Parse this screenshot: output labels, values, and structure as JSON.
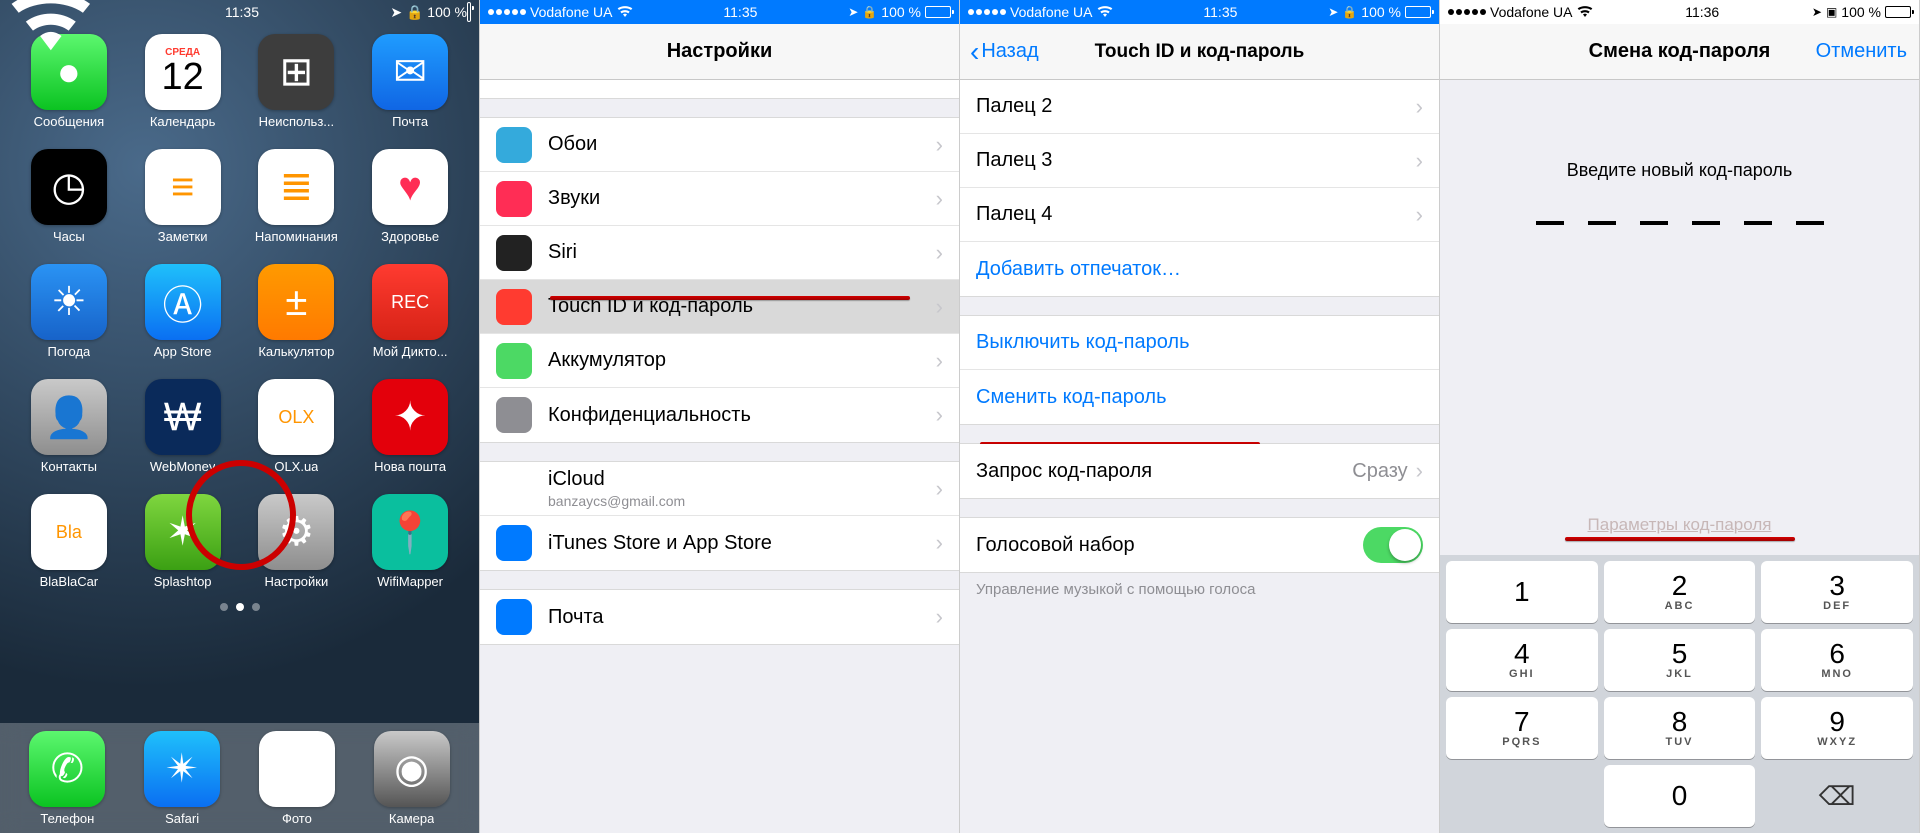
{
  "status": {
    "carrier": "Vodafone UA",
    "time1": "11:35",
    "time4": "11:36",
    "battery": "100 %"
  },
  "screen1": {
    "apps": [
      {
        "label": "Сообщения",
        "bg": "linear-gradient(#5cf76f,#0bc321)",
        "glyph": "●"
      },
      {
        "label": "Календарь",
        "bg": "#fff",
        "glyph": "12",
        "top": "СРЕДА"
      },
      {
        "label": "Неиспольз...",
        "bg": "#3d3d3d",
        "glyph": "⊞"
      },
      {
        "label": "Почта",
        "bg": "linear-gradient(#1f9cff,#1066e4)",
        "glyph": "✉"
      },
      {
        "label": "Часы",
        "bg": "#000",
        "glyph": "◷"
      },
      {
        "label": "Заметки",
        "bg": "#fff",
        "glyph": "≡"
      },
      {
        "label": "Напоминания",
        "bg": "#fff",
        "glyph": "≣"
      },
      {
        "label": "Здоровье",
        "bg": "#fff",
        "glyph": "♥"
      },
      {
        "label": "Погода",
        "bg": "linear-gradient(#2a93f4,#1763c9)",
        "glyph": "☀"
      },
      {
        "label": "App Store",
        "bg": "linear-gradient(#1fc0fb,#0a6ff2)",
        "glyph": "Ⓐ"
      },
      {
        "label": "Калькулятор",
        "bg": "linear-gradient(#ff9a00,#ff7a00)",
        "glyph": "±"
      },
      {
        "label": "Мой Дикто...",
        "bg": "linear-gradient(#ff3b30,#d62216)",
        "glyph": "REC"
      },
      {
        "label": "Контакты",
        "bg": "linear-gradient(#c9c9c9,#8e8e8e)",
        "glyph": "👤"
      },
      {
        "label": "WebMoney",
        "bg": "#0a2a5a",
        "glyph": "₩"
      },
      {
        "label": "OLX.ua",
        "bg": "#fff",
        "glyph": "OLX"
      },
      {
        "label": "Нова пошта",
        "bg": "#e3000b",
        "glyph": "✦"
      },
      {
        "label": "BlaBlaCar",
        "bg": "#fff",
        "glyph": "Bla"
      },
      {
        "label": "Splashtop",
        "bg": "linear-gradient(#7fd63f,#3ba013)",
        "glyph": "✶"
      },
      {
        "label": "Настройки",
        "bg": "linear-gradient(#c9c9c9,#8e8e8e)",
        "glyph": "⚙"
      },
      {
        "label": "WifiMapper",
        "bg": "#0abf9e",
        "glyph": "📍"
      }
    ],
    "dock": [
      {
        "label": "Телефон",
        "bg": "linear-gradient(#5cf76f,#0bc321)",
        "glyph": "✆"
      },
      {
        "label": "Safari",
        "bg": "linear-gradient(#1fc0fb,#0a6ff2)",
        "glyph": "✴"
      },
      {
        "label": "Фото",
        "bg": "#fff",
        "glyph": "✿"
      },
      {
        "label": "Камера",
        "bg": "linear-gradient(#c9c9c9,#555)",
        "glyph": "◉"
      }
    ]
  },
  "screen2": {
    "title": "Настройки",
    "rows1": [
      {
        "label": "Обои",
        "bg": "#34aadc"
      },
      {
        "label": "Звуки",
        "bg": "#ff2d55"
      },
      {
        "label": "Siri",
        "bg": "#222"
      },
      {
        "label": "Touch ID и код-пароль",
        "bg": "#ff3b30",
        "sel": true
      },
      {
        "label": "Аккумулятор",
        "bg": "#4cd964"
      },
      {
        "label": "Конфиденциальность",
        "bg": "#8e8e93"
      }
    ],
    "rows2": [
      {
        "label": "iCloud",
        "sub": "banzaycs@gmail.com",
        "bg": "#fff"
      },
      {
        "label": "iTunes Store и App Store",
        "bg": "#007aff"
      }
    ],
    "rows3": [
      {
        "label": "Почта",
        "bg": "#007aff"
      }
    ]
  },
  "screen3": {
    "back": "Назад",
    "title": "Touch ID и код-пароль",
    "fingers": [
      "Палец 2",
      "Палец 3",
      "Палец 4"
    ],
    "add": "Добавить отпечаток…",
    "disable": "Выключить код-пароль",
    "change": "Сменить код-пароль",
    "request_label": "Запрос код-пароля",
    "request_value": "Сразу",
    "voice": "Голосовой набор",
    "voice_footer": "Управление музыкой с помощью голоса"
  },
  "screen4": {
    "title": "Смена код-пароля",
    "cancel": "Отменить",
    "prompt": "Введите новый код-пароль",
    "options": "Параметры код-пароля",
    "keys": [
      {
        "n": "1",
        "l": ""
      },
      {
        "n": "2",
        "l": "ABC"
      },
      {
        "n": "3",
        "l": "DEF"
      },
      {
        "n": "4",
        "l": "GHI"
      },
      {
        "n": "5",
        "l": "JKL"
      },
      {
        "n": "6",
        "l": "MNO"
      },
      {
        "n": "7",
        "l": "PQRS"
      },
      {
        "n": "8",
        "l": "TUV"
      },
      {
        "n": "9",
        "l": "WXYZ"
      }
    ],
    "zero": "0"
  }
}
